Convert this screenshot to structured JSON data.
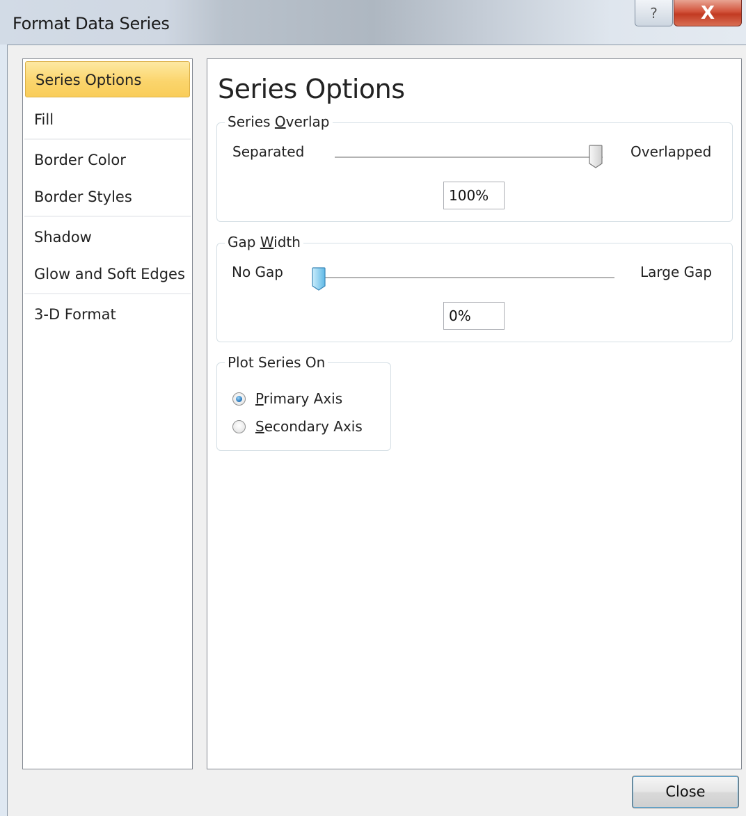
{
  "window": {
    "title": "Format Data Series",
    "help_label": "?",
    "close_label": "X"
  },
  "sidebar": {
    "items": [
      {
        "label": "Series Options",
        "selected": true
      },
      {
        "label": "Fill"
      },
      {
        "label": "Border Color"
      },
      {
        "label": "Border Styles"
      },
      {
        "label": "Shadow"
      },
      {
        "label": "Glow and Soft Edges"
      },
      {
        "label": "3-D Format"
      }
    ]
  },
  "main": {
    "heading": "Series Options",
    "series_overlap": {
      "legend_pre": "Series ",
      "legend_accel": "O",
      "legend_post": "verlap",
      "left_label": "Separated",
      "right_label": "Overlapped",
      "value": "100%",
      "slider_fraction": 1.0
    },
    "gap_width": {
      "legend_pre": "Gap ",
      "legend_accel": "W",
      "legend_post": "idth",
      "left_label": "No Gap",
      "right_label": "Large Gap",
      "value": "0%",
      "slider_fraction": 0.0
    },
    "plot_series_on": {
      "legend": "Plot Series On",
      "options": [
        {
          "accel": "P",
          "rest": "rimary Axis",
          "checked": true
        },
        {
          "accel": "S",
          "rest": "econdary Axis",
          "checked": false
        }
      ]
    }
  },
  "footer": {
    "close_button": "Close"
  },
  "colors": {
    "selected_item": "#fbd56d",
    "accent_blue": "#1f6fb5"
  }
}
